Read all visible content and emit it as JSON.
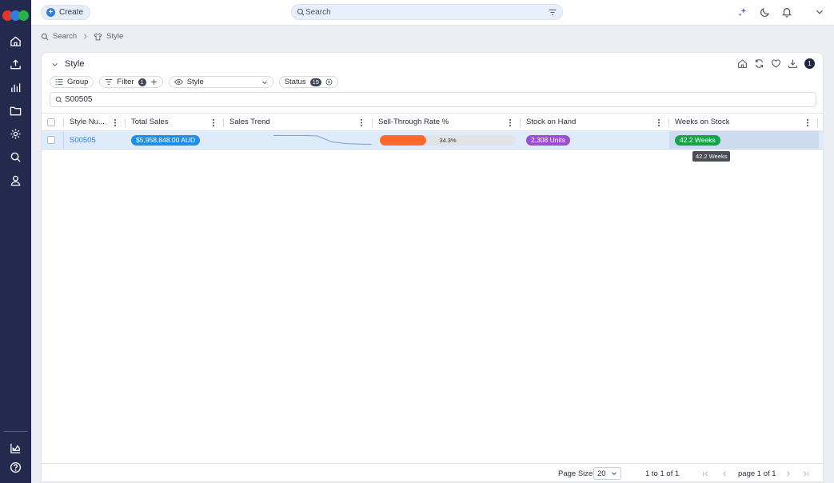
{
  "app": {
    "logo_colors": [
      "#e8352b",
      "#2f7de1",
      "#27b24a"
    ]
  },
  "topbar": {
    "create_label": "Create",
    "search_placeholder": "Search"
  },
  "breadcrumb": {
    "items": [
      "Search",
      "Style"
    ]
  },
  "panel": {
    "title": "Style",
    "badge_count": "1"
  },
  "chips": {
    "group_label": "Group",
    "filter_label": "Filter",
    "filter_count": "1",
    "view_label": "Style",
    "status_label": "Status",
    "status_count": "19"
  },
  "filter_search": {
    "value": "S00505"
  },
  "table": {
    "columns": [
      "Style Nu...",
      "Total Sales",
      "Sales Trend",
      "Sell-Through Rate %",
      "Stock on Hand",
      "Weeks on Stock"
    ],
    "rows": [
      {
        "style_number": "S00505",
        "total_sales": "$5,958,848.00 AUD",
        "sales_trend": [
          0.98,
          0.96,
          0.96,
          0.92,
          0.35,
          0.18,
          0.14,
          0.12,
          0.12,
          0.12
        ],
        "sell_through_label": "34.3%",
        "sell_through_value": 34.3,
        "stock_on_hand": "2,308 Units",
        "weeks_on_stock": "42.2 Weeks"
      }
    ],
    "tooltip": "42.2 Weeks"
  },
  "colors": {
    "sales_pill": "#1f8ee8",
    "stock_pill": "#9b4fd1",
    "weeks_pill": "#16a34a",
    "progress_fill": "#ff6a2b",
    "link": "#2f7de1"
  },
  "footer": {
    "page_size_label": "Page Size",
    "page_size_value": "20",
    "range_label": "1 to 1 of 1",
    "page_label": "page 1 of 1"
  }
}
